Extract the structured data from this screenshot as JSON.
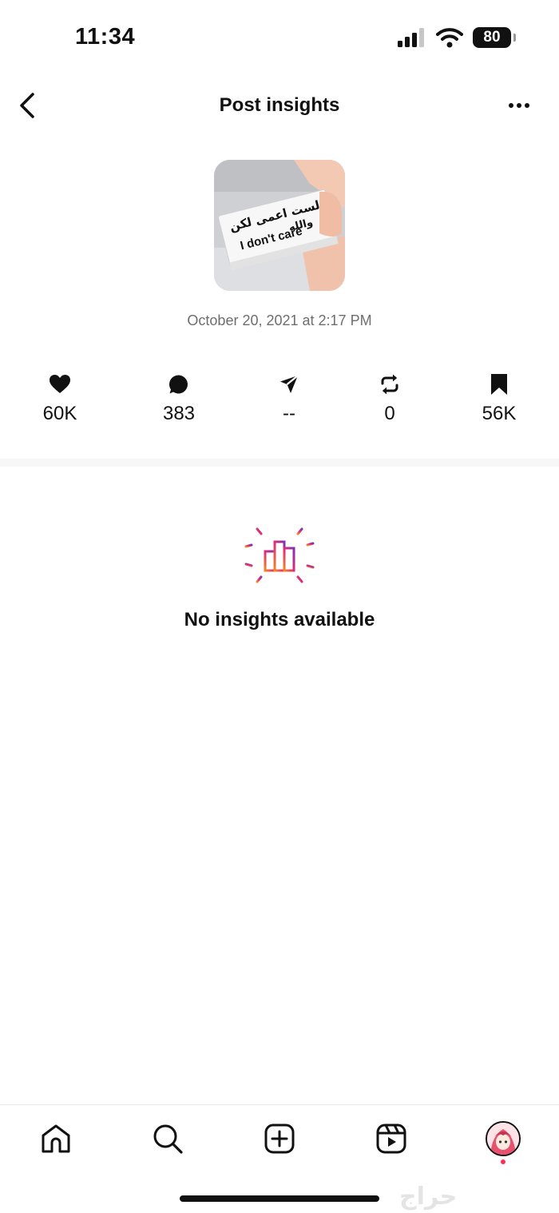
{
  "status_bar": {
    "time": "11:34",
    "battery": "80",
    "signal_icon": "cellular-signal-icon",
    "wifi_icon": "wifi-icon"
  },
  "header": {
    "title": "Post insights",
    "back_icon": "chevron-left-icon",
    "more_icon": "more-horizontal-icon"
  },
  "post": {
    "thumbnail": {
      "text_arabic_line1": "لست اعمى لكن",
      "text_arabic_line2": "والله",
      "text_english": "I don't care"
    },
    "date": "October 20, 2021 at 2:17 PM"
  },
  "metrics": [
    {
      "icon": "heart-icon",
      "value": "60K"
    },
    {
      "icon": "comment-icon",
      "value": "383"
    },
    {
      "icon": "share-icon",
      "value": "--"
    },
    {
      "icon": "repost-icon",
      "value": "0"
    },
    {
      "icon": "bookmark-icon",
      "value": "56K"
    }
  ],
  "insights": {
    "icon": "bar-chart-sparkle-icon",
    "message": "No insights available"
  },
  "tab_bar": {
    "items": [
      {
        "name": "home",
        "icon": "home-icon"
      },
      {
        "name": "search",
        "icon": "search-icon"
      },
      {
        "name": "create",
        "icon": "plus-square-icon"
      },
      {
        "name": "reels",
        "icon": "reels-icon"
      },
      {
        "name": "profile",
        "icon": "avatar"
      }
    ]
  },
  "watermark": "حراج",
  "colors": {
    "accent_pink": "#e1306c",
    "notif_dot": "#ff2d55",
    "secondary_text": "#6e6e6e"
  }
}
